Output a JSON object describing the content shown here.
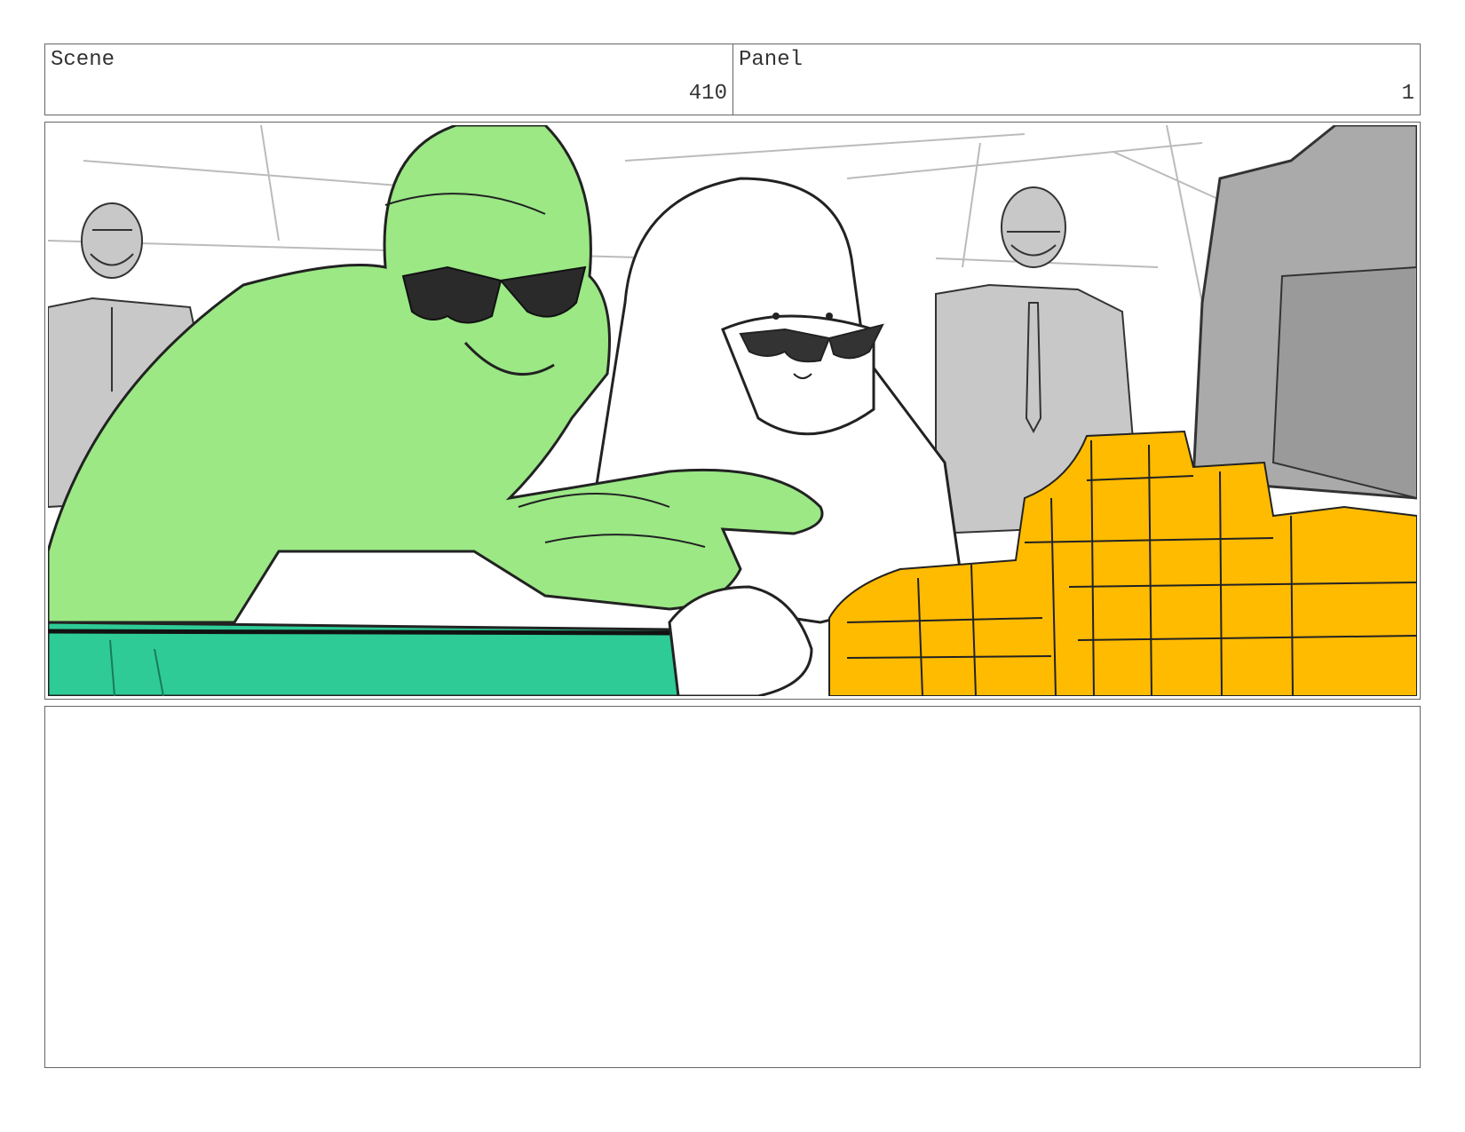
{
  "header": {
    "scene_label": "Scene",
    "scene_value": "410",
    "panel_label": "Panel",
    "panel_value": "1"
  },
  "panel_image": {
    "colors": {
      "green_character": "#9be885",
      "table_green": "#2ecb96",
      "gold_chips": "#ffbb00",
      "background_people": "#c8c8c8",
      "line": "#222222"
    }
  },
  "notes": {
    "text": ""
  }
}
